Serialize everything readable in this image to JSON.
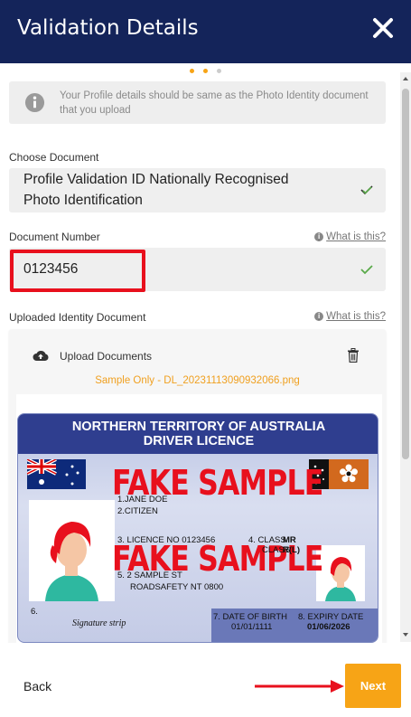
{
  "header": {
    "title": "Validation Details",
    "close_icon": "close-icon"
  },
  "progress": {
    "steps": 3,
    "active": [
      0,
      1
    ]
  },
  "info": {
    "text": "Your Profile details should be same as the Photo Identity document that you upload",
    "icon": "info-icon"
  },
  "choose_document": {
    "label": "Choose Document",
    "value_line1": "Profile Validation ID Nationally Recognised",
    "value_line2": "Photo Identification"
  },
  "document_number": {
    "label": "Document Number",
    "help": "What is this?",
    "value": "0123456"
  },
  "uploaded": {
    "label": "Uploaded Identity Document",
    "help": "What is this?",
    "upload_label": "Upload Documents",
    "filename": "Sample Only - DL_20231113090932066.png"
  },
  "licence": {
    "heading_line1": "NORTHERN TERRITORY OF AUSTRALIA",
    "heading_line2": "DRIVER LICENCE",
    "watermark": "FAKE SAMPLE",
    "name": "1.JANE DOE",
    "citizen": "2.CITIZEN",
    "licence_no": "3.  LICENCE NO 0123456",
    "class_label": "4.  CLASS",
    "class_value": "MR",
    "class_label2": "CLASS",
    "class_value2": "R(L)",
    "address1": "5. 2 SAMPLE ST",
    "address2": "ROADSAFETY NT 0800",
    "field6": "6.",
    "signature": "Signature strip",
    "dob_label": "7. DATE OF BIRTH",
    "dob": "01/01/1111",
    "expiry_label": "8. EXPIRY DATE",
    "expiry": "01/06/2026"
  },
  "footer": {
    "back_label": "Back",
    "next_label": "Next"
  },
  "colors": {
    "header": "#14245a",
    "accent": "#f7a416",
    "highlight": "#e8101d",
    "check": "#5aaa4a"
  }
}
